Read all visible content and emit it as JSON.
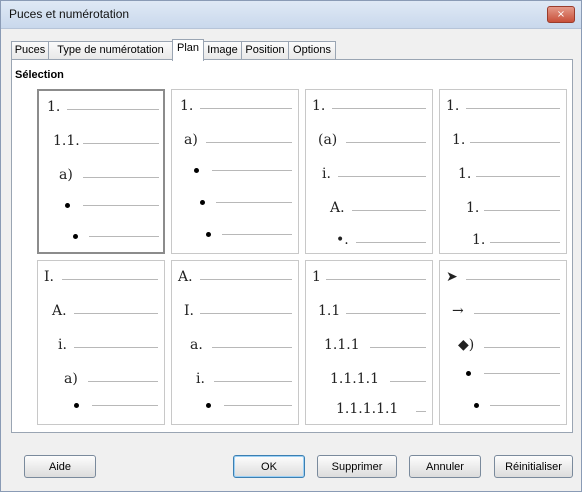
{
  "window": {
    "title": "Puces et numérotation",
    "close_glyph": "×"
  },
  "tabs": [
    {
      "label": "Puces"
    },
    {
      "label": "Type de numérotation"
    },
    {
      "label": "Plan"
    },
    {
      "label": "Image"
    },
    {
      "label": "Position"
    },
    {
      "label": "Options"
    }
  ],
  "section": {
    "label": "Sélection"
  },
  "presets": [
    {
      "selected": true,
      "levels": [
        "1.",
        "1.1.",
        "a)",
        "•",
        "•"
      ]
    },
    {
      "levels": [
        "1.",
        "a)",
        "•",
        "•",
        "•"
      ]
    },
    {
      "levels": [
        "1.",
        "(a)",
        "i.",
        "A.",
        "•."
      ]
    },
    {
      "levels": [
        "1.",
        "1.",
        "1.",
        "1.",
        "1."
      ]
    },
    {
      "levels": [
        "I.",
        "A.",
        "i.",
        "a)",
        "•"
      ]
    },
    {
      "levels": [
        "A.",
        "I.",
        "a.",
        "i.",
        "•"
      ]
    },
    {
      "levels": [
        "1",
        "1.1",
        "1.1.1",
        "1.1.1.1",
        "1.1.1.1.1"
      ]
    },
    {
      "levels": [
        "➤",
        "→",
        "◆)",
        "•",
        "•"
      ]
    }
  ],
  "buttons": {
    "help": "Aide",
    "ok": "OK",
    "delete": "Supprimer",
    "cancel": "Annuler",
    "reset": "Réinitialiser"
  }
}
